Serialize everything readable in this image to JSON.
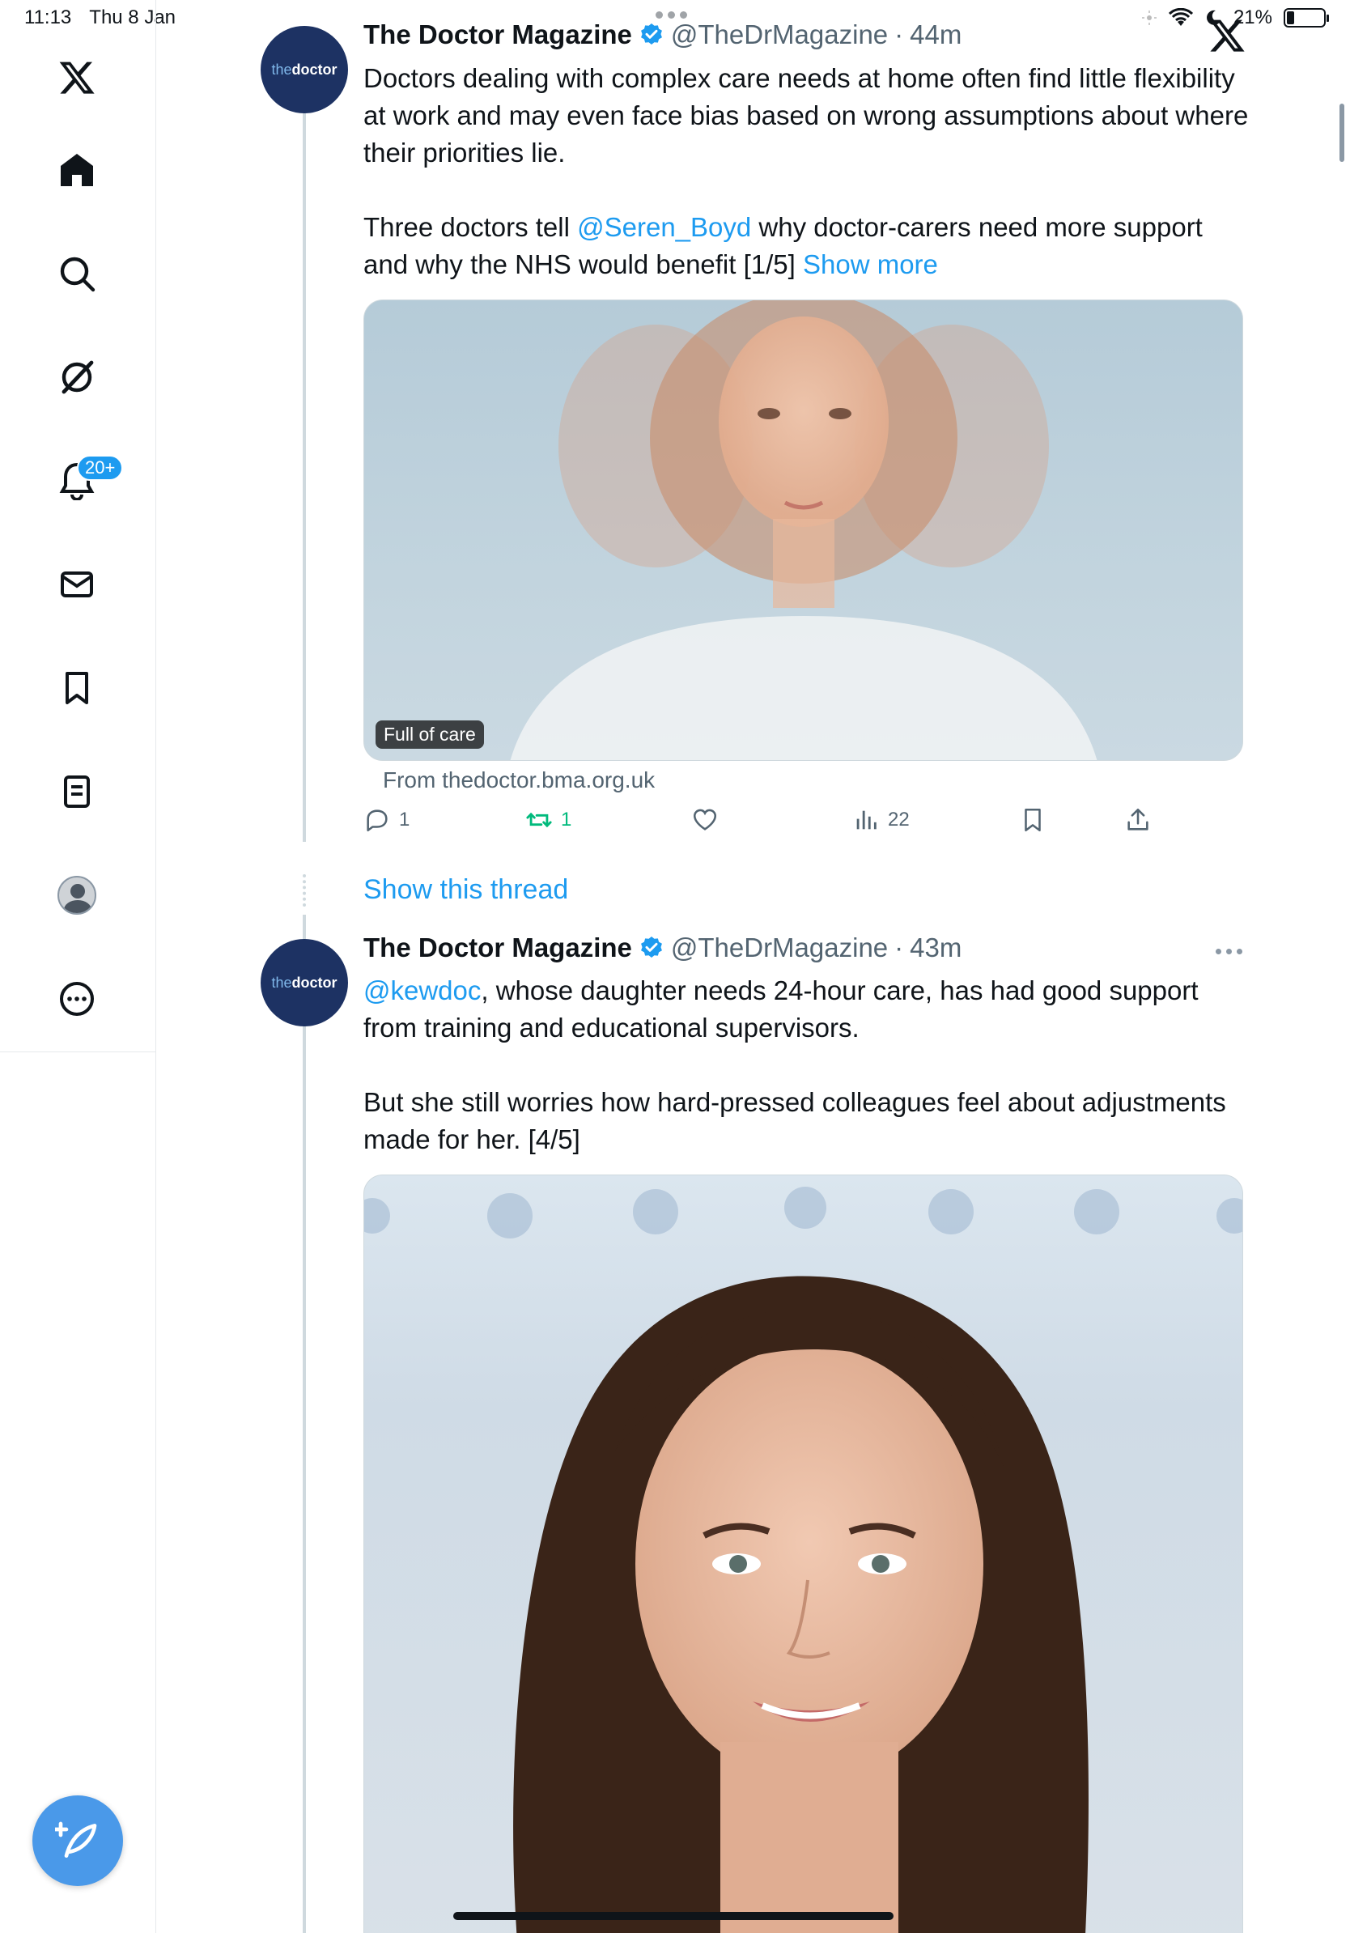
{
  "status_bar": {
    "time": "11:13",
    "date": "Thu 8 Jan",
    "battery": "21%",
    "battery_level": 0.21
  },
  "sidebar": {
    "items": [
      {
        "name": "x-logo-icon"
      },
      {
        "name": "home-icon"
      },
      {
        "name": "search-icon"
      },
      {
        "name": "grok-icon"
      },
      {
        "name": "notifications-bell-icon",
        "badge": "20+"
      },
      {
        "name": "messages-envelope-icon"
      },
      {
        "name": "bookmark-icon"
      },
      {
        "name": "lists-icon"
      },
      {
        "name": "profile-avatar"
      },
      {
        "name": "more-icon"
      }
    ],
    "compose_icon": "feather-plus-icon"
  },
  "tweets": [
    {
      "author": "The Doctor Magazine",
      "handle": "@TheDrMagazine",
      "sep": "·",
      "time": "44m",
      "avatar_text_1": "the",
      "avatar_text_2": "doctor",
      "paragraph1": "Doctors dealing with complex care needs at home often find little flexibility at work and may even face bias based on wrong assumptions about where their priorities lie.",
      "p2_before": "Three doctors tell ",
      "p2_mention": "@Seren_Boyd",
      "p2_after": " why doctor-carers need more support and why the NHS would benefit [1/5] ",
      "show_more": "Show more",
      "card_label": "Full of care",
      "card_source": "From thedoctor.bma.org.uk",
      "replies": "1",
      "retweets": "1",
      "views": "22",
      "retweet_color": "#00ba7c",
      "show_thread": "Show this thread"
    },
    {
      "author": "The Doctor Magazine",
      "handle": "@TheDrMagazine",
      "sep": "·",
      "time": "43m",
      "avatar_text_1": "the",
      "avatar_text_2": "doctor",
      "p1_mention": "@kewdoc",
      "p1_after": ", whose daughter needs 24-hour care, has had good support from training and educational supervisors.",
      "paragraph2": "But she still worries how hard-pressed colleagues feel about adjustments made for her. [4/5]"
    }
  ],
  "colors": {
    "accent": "#1d9bf0",
    "fab": "#4a99e9",
    "avatar_bg": "#1d3263"
  }
}
